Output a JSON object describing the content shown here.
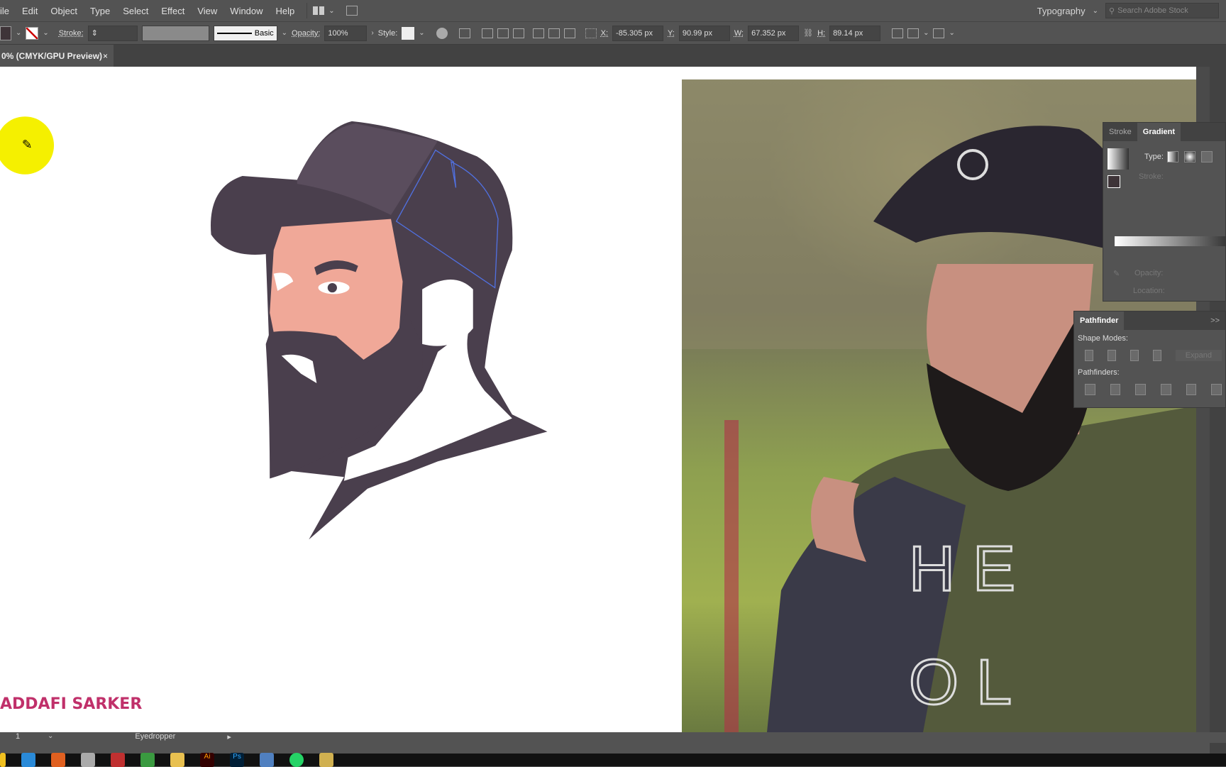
{
  "menu": [
    "ile",
    "Edit",
    "Object",
    "Type",
    "Select",
    "Effect",
    "View",
    "Window",
    "Help"
  ],
  "workspace": "Typography",
  "search_placeholder": "Search Adobe Stock",
  "control": {
    "stroke_label": "Stroke:",
    "brush": "Basic",
    "opacity_label": "Opacity:",
    "opacity": "100%",
    "style_label": "Style:",
    "x_label": "X:",
    "x": "-85.305 px",
    "y_label": "Y:",
    "y": "90.99 px",
    "w_label": "W:",
    "w": "67.352 px",
    "h_label": "H:",
    "h": "89.14 px"
  },
  "doc_tab": {
    "title": "0% (CMYK/GPU Preview)",
    "close": "×"
  },
  "gradient_panel": {
    "tabs": [
      "Stroke",
      "Gradient"
    ],
    "type_label": "Type:",
    "stroke_label": "Stroke:",
    "opacity_label": "Opacity:",
    "location_label": "Location:"
  },
  "pathfinder_panel": {
    "title": "Pathfinder",
    "shape_modes": "Shape Modes:",
    "expand": "Expand",
    "pathfinders": "Pathfinders:",
    "menu": ">>"
  },
  "artwork_credit": "ADDAFI SARKER",
  "status": {
    "artboard": "1",
    "tool": "Eyedropper"
  },
  "taskbar_apps": [
    "chrome",
    "safari",
    "app",
    "app",
    "app",
    "ie",
    "file-explorer",
    "Ai",
    "Ps",
    "app",
    "whatsapp",
    "app"
  ],
  "colors": {
    "cap": "#4a3f4d",
    "skin": "#f0a898",
    "credit": "#c0306a",
    "highlight": "#f5f000"
  }
}
